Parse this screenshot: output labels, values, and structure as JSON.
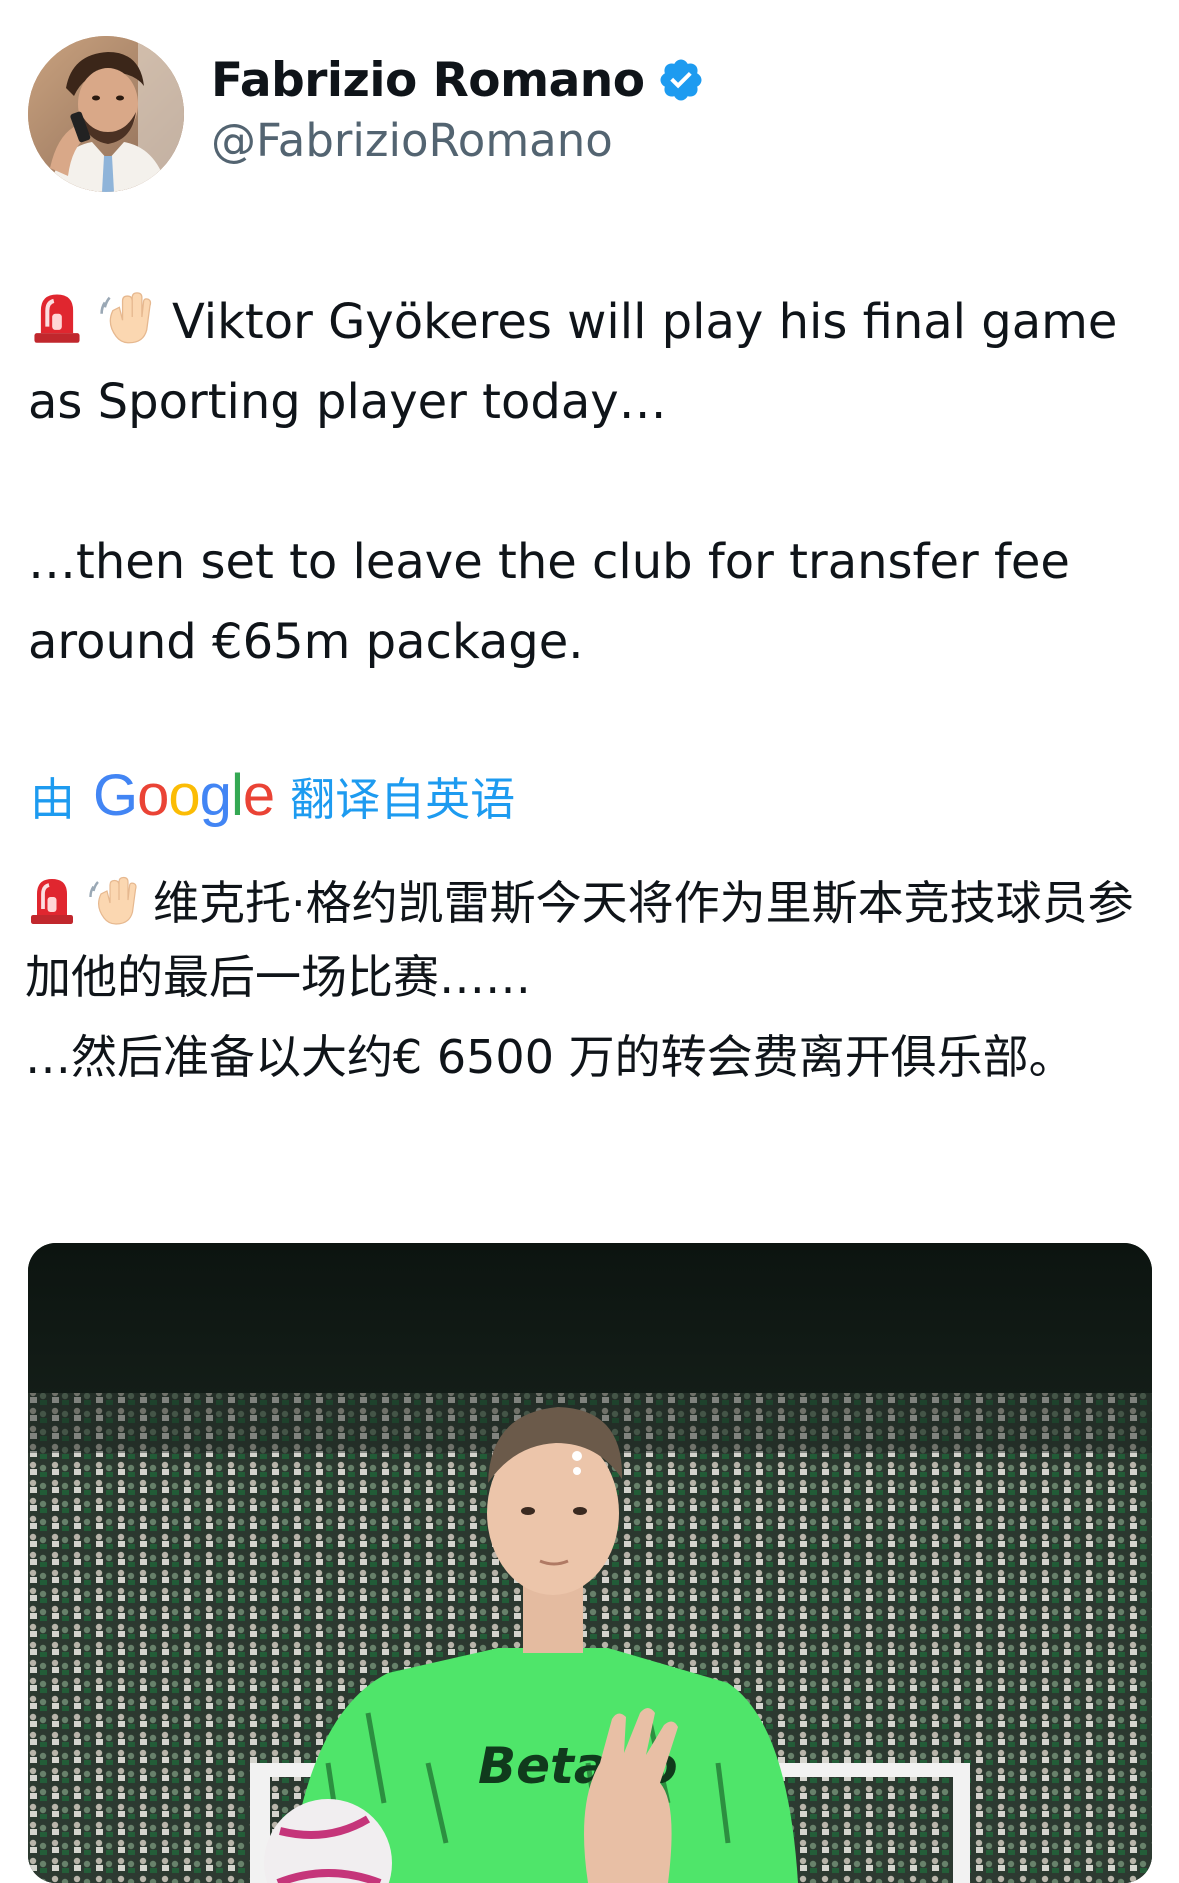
{
  "author": {
    "display_name": "Fabrizio Romano",
    "handle": "@FabrizioRomano",
    "verified": true,
    "avatar_icon": "profile-photo",
    "verified_icon": "verified-badge-icon",
    "verified_color": "#1d9bf0"
  },
  "tweet": {
    "paragraph_1_emojis": [
      "rotating-light-icon",
      "waving-hand-icon"
    ],
    "paragraph_1": "Viktor Gyökeres will play his final game as Sporting player today…",
    "paragraph_2": "…then set to leave the club for transfer fee around €65m package."
  },
  "translation": {
    "prefix": "由",
    "brand": "Google",
    "suffix": "翻译自英语",
    "link_color": "#1d9bf0",
    "paragraph_1_emojis": [
      "rotating-light-icon",
      "waving-hand-icon"
    ],
    "paragraph_1": "维克托·格约凯雷斯今天将作为里斯本竞技球员参加他的最后一场比赛……",
    "paragraph_2": "…然后准备以大约€ 6500 万的转会费离开俱乐部。"
  },
  "media": {
    "type": "photo",
    "jersey_sponsor": "Betano",
    "jersey_color": "#4fe56a"
  }
}
